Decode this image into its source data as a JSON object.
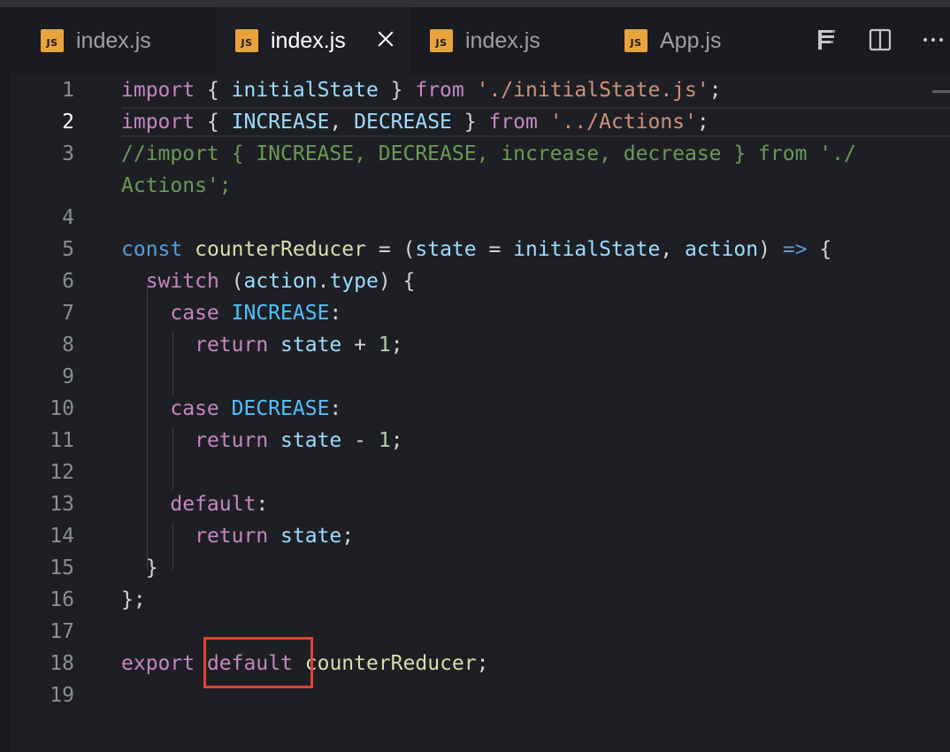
{
  "tabs": [
    {
      "label": "index.js",
      "badge": "JS",
      "active": false
    },
    {
      "label": "index.js",
      "badge": "JS",
      "active": true
    },
    {
      "label": "index.js",
      "badge": "JS",
      "active": false
    },
    {
      "label": "App.js",
      "badge": "JS",
      "active": false
    }
  ],
  "tab_actions": [
    "prettier-icon",
    "split-editor-icon",
    "more-actions-icon"
  ],
  "current_line": 2,
  "line_numbers": [
    "1",
    "2",
    "3",
    "",
    "4",
    "5",
    "6",
    "7",
    "8",
    "9",
    "10",
    "11",
    "12",
    "13",
    "14",
    "15",
    "16",
    "17",
    "18",
    "19"
  ],
  "tokens": {
    "import": "import",
    "from": "from",
    "const": "const",
    "switch": "switch",
    "case": "case",
    "return": "return",
    "default": "default",
    "export": "export",
    "initialState": "initialState",
    "INCREASE": "INCREASE",
    "DECREASE": "DECREASE",
    "counterReducer": "counterReducer",
    "state": "state",
    "action": "action",
    "type": "type",
    "str_initial": "'./initialState.js'",
    "str_actions": "'../Actions'",
    "comment_a": "//import { INCREASE, DECREASE, increase, decrease } from './",
    "comment_b": "Actions';",
    "one": "1",
    "arrow": "=>"
  },
  "colors": {
    "background": "#1e1f25",
    "tabbar": "#1a1b21",
    "keyword_control": "#c586c0",
    "keyword_storage": "#569cd6",
    "variable": "#9cdcfe",
    "constant": "#4fc1ff",
    "function": "#dcdcaa",
    "string": "#ce9178",
    "number": "#b5cea8",
    "comment": "#6a9955",
    "js_badge": "#e8a33d",
    "highlight_box": "#e0422e"
  }
}
